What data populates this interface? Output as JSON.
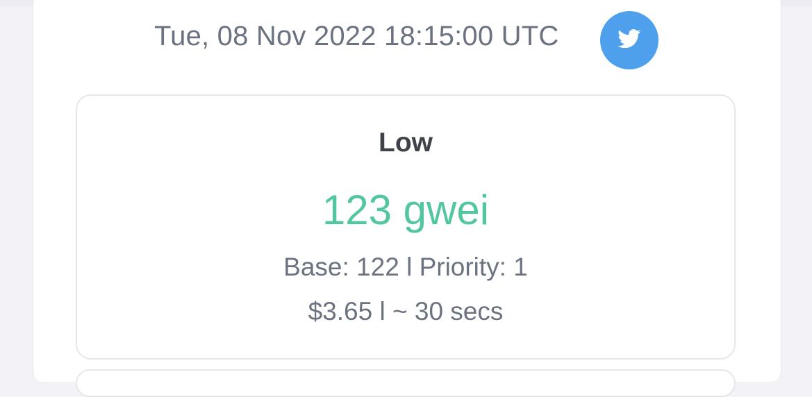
{
  "header": {
    "timestamp": "Tue, 08 Nov 2022 18:15:00 UTC",
    "share_icon": "twitter-icon"
  },
  "gas_card": {
    "tier": "Low",
    "price": "123 gwei",
    "breakdown": "Base: 122 l Priority: 1",
    "cost_time": "$3.65 l ~ 30 secs"
  },
  "colors": {
    "price_accent": "#52c6a0",
    "twitter_blue": "#4ea0ec",
    "muted_text": "#6b7280"
  }
}
